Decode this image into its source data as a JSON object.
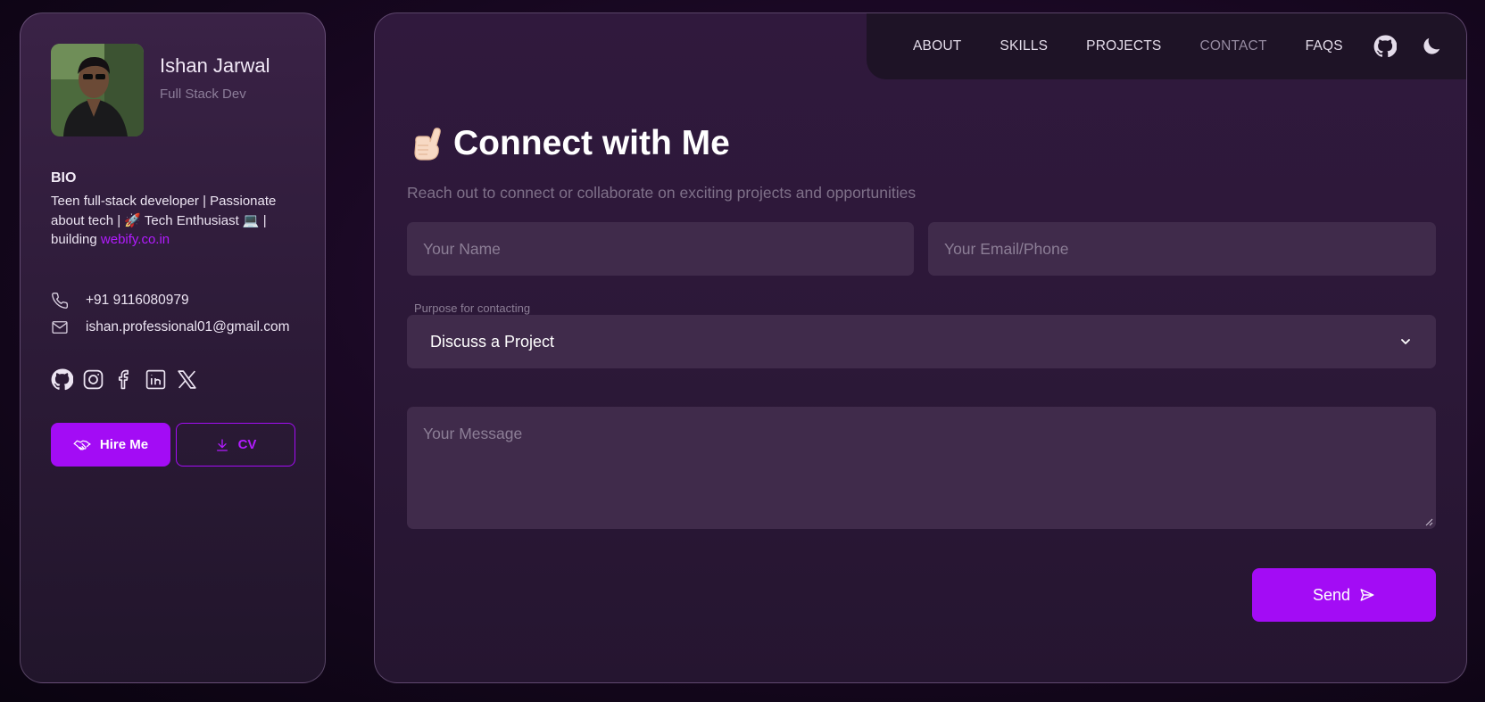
{
  "colors": {
    "accent": "#a30cf5",
    "link": "#b21bff",
    "panel": "#30193d",
    "field": "#402b4b",
    "muted_text": "#7f7089"
  },
  "profile": {
    "name": "Ishan Jarwal",
    "role": "Full Stack Dev",
    "avatar_icon": "profile-photo",
    "bio_title": "BIO",
    "bio_part1": "Teen full-stack developer | Passionate about tech | 🚀 Tech Enthusiast 💻 | building ",
    "bio_link": "webify.co.in",
    "phone": "+91 9116080979",
    "email": "ishan.professional01@gmail.com",
    "socials": [
      "github-icon",
      "instagram-icon",
      "facebook-icon",
      "linkedin-icon",
      "x-icon"
    ],
    "hire_label": "Hire Me",
    "cv_label": "CV"
  },
  "nav": {
    "items": [
      "ABOUT",
      "SKILLS",
      "PROJECTS",
      "CONTACT",
      "FAQS"
    ],
    "active": "CONTACT",
    "icons": [
      "github-icon",
      "moon-icon"
    ]
  },
  "contact": {
    "title": "Connect with Me",
    "title_icon": "call-me-hand-emoji",
    "subtitle": "Reach out to connect or collaborate on exciting projects and opportunities",
    "name_placeholder": "Your Name",
    "email_placeholder": "Your Email/Phone",
    "purpose_label": "Purpose for contacting",
    "purpose_value": "Discuss a Project",
    "message_placeholder": "Your Message",
    "send_label": "Send"
  }
}
